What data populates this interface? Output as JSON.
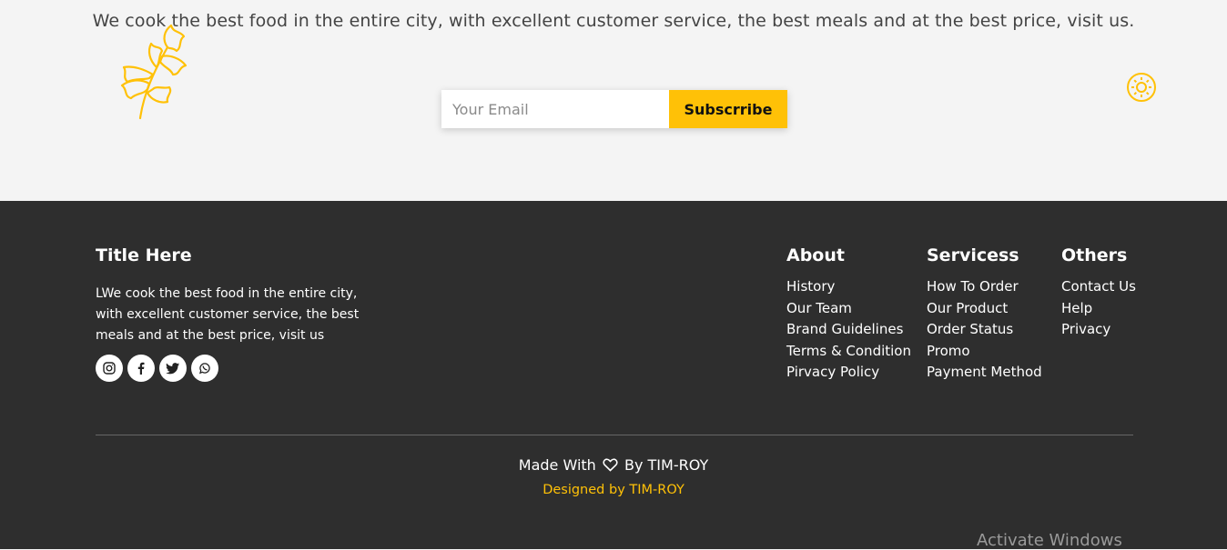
{
  "newsletter": {
    "tagline": "We cook the best food in the entire city, with excellent customer service, the best meals and at the best price, visit us.",
    "email_placeholder": "Your Email",
    "subscribe_label": "Subscrribe"
  },
  "footer": {
    "brand": {
      "title": "Title Here",
      "description": "LWe cook the best food in the entire city, with excellent customer service, the best meals and at the best price, visit us",
      "socials": [
        "instagram-icon",
        "facebook-icon",
        "twitter-icon",
        "whatsapp-icon"
      ]
    },
    "about": {
      "heading": "About",
      "links": [
        "History",
        "Our Team",
        "Brand Guidelines",
        "Terms & Condition",
        "Pirvacy Policy"
      ]
    },
    "services": {
      "heading": "Servicess",
      "links": [
        "How To Order",
        "Our Product",
        "Order Status",
        "Promo",
        "Payment Method"
      ]
    },
    "others": {
      "heading": "Others",
      "links": [
        "Contact Us",
        "Help",
        "Privacy"
      ]
    },
    "made_with_prefix": "Made With",
    "made_with_suffix": "By TIM-ROY",
    "designed_by": "Designed by TIM-ROY"
  },
  "os": {
    "watermark": "Activate Windows"
  },
  "colors": {
    "accent": "#ffc107",
    "footer_bg": "#2e2e2e",
    "page_bg": "#f4f4f4"
  }
}
